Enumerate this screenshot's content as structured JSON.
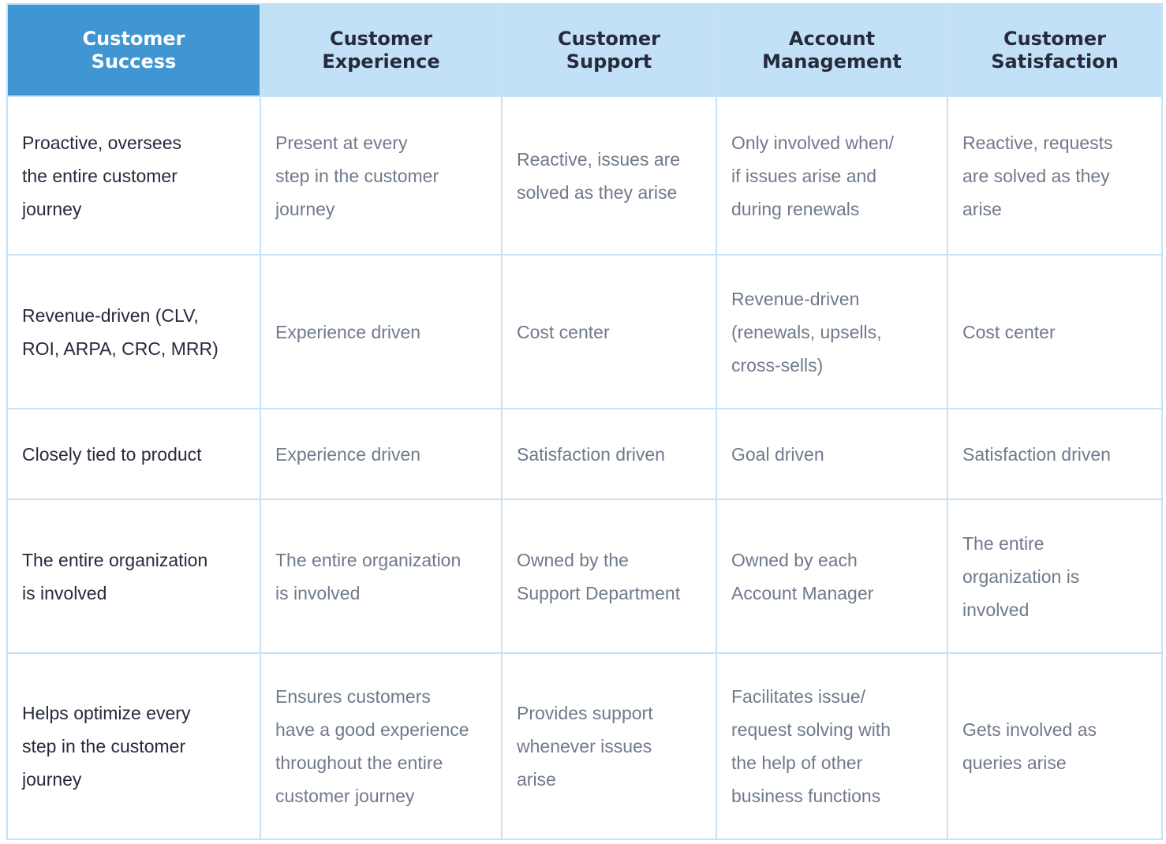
{
  "colors": {
    "primary_header_bg": "#3f96d3",
    "header_bg": "#c3e1f6",
    "border": "#c7e2f7",
    "first_col_text": "#262a3c",
    "body_text": "#6f7a8b"
  },
  "table": {
    "headers": [
      "Customer\nSuccess",
      "Customer\nExperience",
      "Customer\nSupport",
      "Account\nManagement",
      "Customer\nSatisfaction"
    ],
    "rows": [
      [
        "Proactive, oversees\nthe entire customer\njourney",
        "Present at every\nstep in the customer\njourney",
        "Reactive, issues are\nsolved as they arise",
        "Only involved when/\nif issues arise and\nduring renewals",
        "Reactive, requests\nare solved as they\narise"
      ],
      [
        "Revenue-driven (CLV,\nROI, ARPA, CRC, MRR)",
        "Experience driven",
        "Cost center",
        "Revenue-driven\n(renewals, upsells,\ncross-sells)",
        "Cost center"
      ],
      [
        "Closely tied to product",
        "Experience driven",
        "Satisfaction driven",
        "Goal driven",
        "Satisfaction driven"
      ],
      [
        "The entire organization\nis involved",
        "The entire organization\nis involved",
        "Owned by the\nSupport Department",
        "Owned by each\nAccount Manager",
        "The entire\norganization is\ninvolved"
      ],
      [
        "Helps optimize every\nstep in the customer\njourney",
        "Ensures customers\nhave a good experience\nthroughout the entire\ncustomer journey",
        "Provides support\nwhenever issues\narise",
        "Facilitates issue/\nrequest solving with\nthe help of other\nbusiness functions",
        "Gets involved as\nqueries arise"
      ]
    ]
  }
}
